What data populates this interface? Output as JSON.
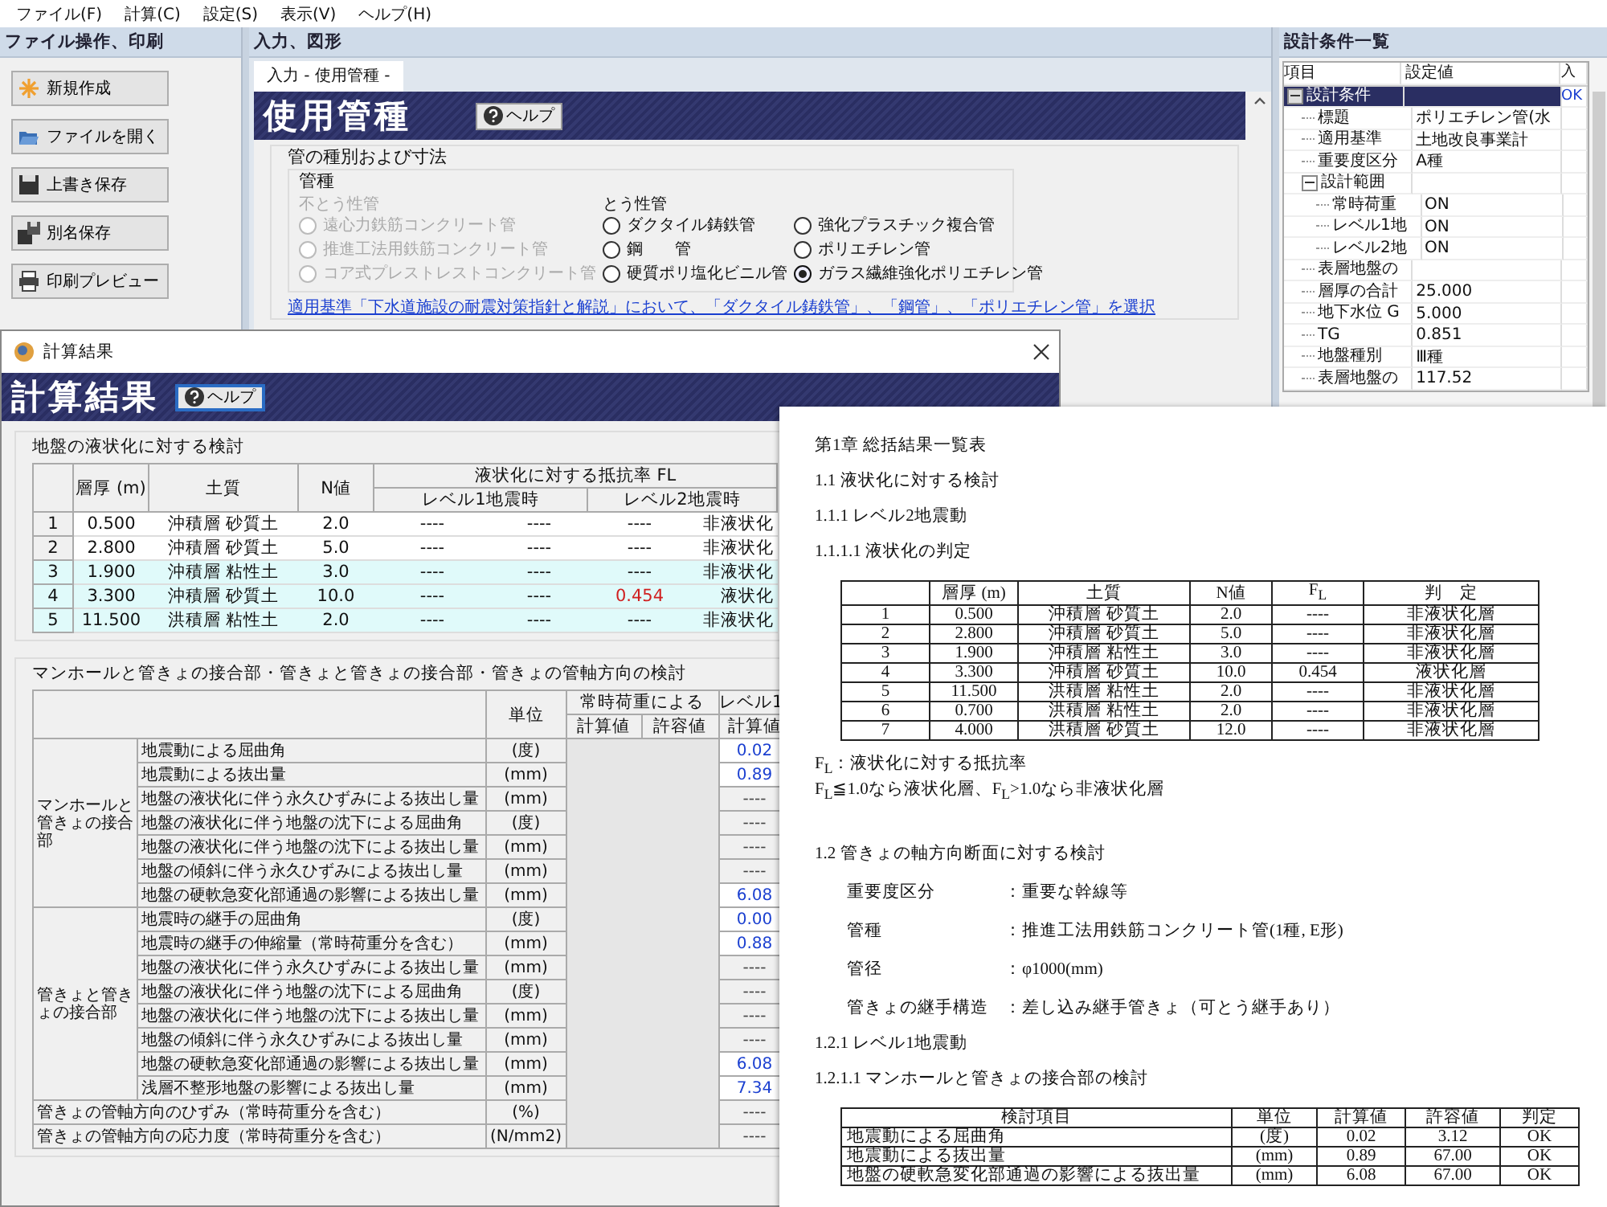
{
  "menu": [
    "ファイル(F)",
    "計算(C)",
    "設定(S)",
    "表示(V)",
    "ヘルプ(H)"
  ],
  "left_panel": {
    "title": "ファイル操作、印刷",
    "buttons": [
      "新規作成",
      "ファイルを開く",
      "上書き保存",
      "別名保存",
      "印刷プレビュー"
    ]
  },
  "center_panel": {
    "title": "入力、図形",
    "tab": "入力 - 使用管種 -",
    "heading": "使用管種",
    "help": "ヘルプ",
    "group_title": "管の種別および寸法",
    "pipe_type": {
      "title": "管種",
      "columns": [
        {
          "title": "不とう性管",
          "options": [
            {
              "label": "遠心力鉄筋コンクリート管",
              "selected": false,
              "disabled": true
            },
            {
              "label": "推進工法用鉄筋コンクリート管",
              "selected": false,
              "disabled": true
            },
            {
              "label": "コア式プレストレストコンクリート管",
              "selected": false,
              "disabled": true
            }
          ]
        },
        {
          "title": "とう性管",
          "options": [
            {
              "label": "ダクタイル鋳鉄管",
              "selected": false,
              "disabled": false
            },
            {
              "label": "鋼　　管",
              "selected": false,
              "disabled": false
            },
            {
              "label": "硬質ポリ塩化ビニル管",
              "selected": false,
              "disabled": false
            }
          ]
        },
        {
          "options": [
            {
              "label": "強化プラスチック複合管",
              "selected": false,
              "disabled": false
            },
            {
              "label": "ポリエチレン管",
              "selected": false,
              "disabled": false
            },
            {
              "label": "ガラス繊維強化ポリエチレン管",
              "selected": true,
              "disabled": false
            }
          ]
        }
      ]
    },
    "note": "適用基準「下水道施設の耐震対策指針と解説」において、「ダクタイル鋳鉄管」、「鋼管」、「ポリエチレン管」を選択"
  },
  "right_panel": {
    "title": "設計条件一覧",
    "columns": [
      "項目",
      "設定値",
      "入"
    ],
    "rows": [
      {
        "item": "設計条件",
        "status": "OK",
        "selected": true,
        "expanded": true,
        "children": [
          {
            "item": "標題",
            "value": "ポリエチレン管(水",
            "selected": false
          },
          {
            "item": "適用基準",
            "value": "土地改良事業計",
            "selected": false
          },
          {
            "item": "重要度区分",
            "value": "A種",
            "selected": false
          },
          {
            "item": "設計範囲",
            "selected": false,
            "expanded": true,
            "children": [
              {
                "item": "常時荷重",
                "value": "ON",
                "selected": false
              },
              {
                "item": "レベル1地",
                "value": "ON",
                "selected": false
              },
              {
                "item": "レベル2地",
                "value": "ON",
                "selected": false
              }
            ]
          },
          {
            "item": "表層地盤の",
            "selected": false
          },
          {
            "item": "層厚の合計",
            "value": "25.000",
            "selected": false
          },
          {
            "item": "地下水位 G",
            "value": "5.000",
            "selected": false
          },
          {
            "item": "TG",
            "value": "0.851",
            "selected": false
          },
          {
            "item": "地盤種別",
            "value": "Ⅲ種",
            "selected": false
          },
          {
            "item": "表層地盤の",
            "value": "117.52",
            "selected": false
          }
        ]
      }
    ]
  },
  "dialog": {
    "title": "計算結果",
    "heading": "計算結果",
    "help": "ヘルプ",
    "liquefaction": {
      "title": "地盤の液状化に対する検討",
      "headers": {
        "thickness": "層厚 (m)",
        "soil": "土質",
        "n": "N値",
        "fl": "液状化に対する抵抗率 FL",
        "level1": "レベル1地震時",
        "level2": "レベル2地震時"
      },
      "rows": [
        {
          "no": "1",
          "thickness": "0.500",
          "soil": "沖積層 砂質土",
          "n": "2.0",
          "values": [
            "----",
            "----",
            "----",
            "非液状化"
          ],
          "highlighted": false,
          "alert": false
        },
        {
          "no": "2",
          "thickness": "2.800",
          "soil": "沖積層 砂質土",
          "n": "5.0",
          "values": [
            "----",
            "----",
            "----",
            "非液状化"
          ],
          "highlighted": false,
          "alert": false
        },
        {
          "no": "3",
          "thickness": "1.900",
          "soil": "沖積層 粘性土",
          "n": "3.0",
          "values": [
            "----",
            "----",
            "----",
            "非液状化"
          ],
          "highlighted": true,
          "alert": false
        },
        {
          "no": "4",
          "thickness": "3.300",
          "soil": "沖積層 砂質土",
          "n": "10.0",
          "values": [
            "----",
            "----",
            "0.454",
            "液状化"
          ],
          "highlighted": true,
          "alert": true
        },
        {
          "no": "5",
          "thickness": "11.500",
          "soil": "洪積層 粘性土",
          "n": "2.0",
          "values": [
            "----",
            "----",
            "----",
            "非液状化"
          ],
          "highlighted": true,
          "alert": false
        }
      ]
    },
    "joints": {
      "title": "マンホールと管きょの接合部・管きょと管きょの接合部・管きょの管軸方向の検討",
      "headers": {
        "unit": "単位",
        "normal": "常時荷重による",
        "calc": "計算値",
        "allow": "許容値",
        "level1": "レベル1",
        "calc2": "計算値"
      },
      "groups": [
        {
          "label": "マンホールと管きょの接合部",
          "rows": [
            {
              "item": "地震動による屈曲角",
              "unit": "(度)",
              "value": "0.02",
              "kind": "number"
            },
            {
              "item": "地震動による抜出量",
              "unit": "(mm)",
              "value": "0.89",
              "kind": "number"
            },
            {
              "item": "地盤の液状化に伴う永久ひずみによる抜出し量",
              "unit": "(mm)",
              "value": "----",
              "kind": "dash"
            },
            {
              "item": "地盤の液状化に伴う地盤の沈下による屈曲角",
              "unit": "(度)",
              "value": "----",
              "kind": "dash"
            },
            {
              "item": "地盤の液状化に伴う地盤の沈下による抜出し量",
              "unit": "(mm)",
              "value": "----",
              "kind": "dash"
            },
            {
              "item": "地盤の傾斜に伴う永久ひずみによる抜出し量",
              "unit": "(mm)",
              "value": "----",
              "kind": "dash"
            },
            {
              "item": "地盤の硬軟急変化部通過の影響による抜出し量",
              "unit": "(mm)",
              "value": "6.08",
              "kind": "number"
            }
          ]
        },
        {
          "label": "管きょと管きょの接合部",
          "rows": [
            {
              "item": "地震時の継手の屈曲角",
              "unit": "(度)",
              "value": "0.00",
              "kind": "number"
            },
            {
              "item": "地震時の継手の伸縮量（常時荷重分を含む）",
              "unit": "(mm)",
              "value": "0.88",
              "kind": "number"
            },
            {
              "item": "地盤の液状化に伴う永久ひずみによる抜出し量",
              "unit": "(mm)",
              "value": "----",
              "kind": "dash"
            },
            {
              "item": "地盤の液状化に伴う地盤の沈下による屈曲角",
              "unit": "(度)",
              "value": "----",
              "kind": "dash"
            },
            {
              "item": "地盤の液状化に伴う地盤の沈下による抜出し量",
              "unit": "(mm)",
              "value": "----",
              "kind": "dash"
            },
            {
              "item": "地盤の傾斜に伴う永久ひずみによる抜出し量",
              "unit": "(mm)",
              "value": "----",
              "kind": "dash"
            },
            {
              "item": "地盤の硬軟急変化部通過の影響による抜出し量",
              "unit": "(mm)",
              "value": "6.08",
              "kind": "number"
            },
            {
              "item": "浅層不整形地盤の影響による抜出し量",
              "unit": "(mm)",
              "value": "7.34",
              "kind": "number"
            }
          ]
        }
      ],
      "rows": [
        {
          "item": "管きょの管軸方向のひずみ（常時荷重分を含む）",
          "unit": "(%)",
          "value": "----",
          "kind": "dash"
        },
        {
          "item": "管きょの管軸方向の応力度（常時荷重分を含む）",
          "unit": "(N/mm2)",
          "value": "----",
          "kind": "dash"
        }
      ]
    }
  },
  "report": {
    "blocks": [
      {
        "kind": "heading",
        "text": "第1章 総括結果一覧表"
      },
      {
        "kind": "heading",
        "text": "1.1 液状化に対する検討"
      },
      {
        "kind": "heading",
        "text": "1.1.1 レベル2地震動"
      },
      {
        "kind": "heading",
        "text": "1.1.1.1 液状化の判定"
      },
      {
        "kind": "table",
        "columns": [
          "",
          "層厚 (m)",
          "土質",
          "N値",
          "F$_{L}$",
          "判　定"
        ],
        "rows": [
          [
            "1",
            "0.500",
            "沖積層 砂質土",
            "2.0",
            "----",
            "非液状化層"
          ],
          [
            "2",
            "2.800",
            "沖積層 砂質土",
            "5.0",
            "----",
            "非液状化層"
          ],
          [
            "3",
            "1.900",
            "沖積層 粘性土",
            "3.0",
            "----",
            "非液状化層"
          ],
          [
            "4",
            "3.300",
            "沖積層 砂質土",
            "10.0",
            "0.454",
            "液状化層"
          ],
          [
            "5",
            "11.500",
            "洪積層 粘性土",
            "2.0",
            "----",
            "非液状化層"
          ],
          [
            "6",
            "0.700",
            "洪積層 粘性土",
            "2.0",
            "----",
            "非液状化層"
          ],
          [
            "7",
            "4.000",
            "洪積層 砂質土",
            "12.0",
            "----",
            "非液状化層"
          ]
        ]
      },
      {
        "kind": "note",
        "lines": [
          "F$_{L}$：液状化に対する抵抗率",
          "F$_{L}$≦1.0なら液状化層、F$_{L}$>1.0なら非液状化層"
        ]
      },
      {
        "kind": "heading",
        "text": "1.2 管きょの軸方向断面に対する検討"
      },
      {
        "kind": "field",
        "label": "重要度区分",
        "value": "：重要な幹線等"
      },
      {
        "kind": "field",
        "label": "管種",
        "value": "：推進工法用鉄筋コンクリート管(1種, E形)"
      },
      {
        "kind": "field",
        "label": "管径",
        "value": "：φ1000(mm)"
      },
      {
        "kind": "field",
        "label": "管きょの継手構造",
        "value": "：差し込み継手管きょ（可とう継手あり）"
      },
      {
        "kind": "heading",
        "text": "1.2.1 レベル1地震動"
      },
      {
        "kind": "heading",
        "text": "1.2.1.1 マンホールと管きょの接合部の検討"
      },
      {
        "kind": "table",
        "columns": [
          "検討項目",
          "単位",
          "計算値",
          "許容値",
          "判定"
        ],
        "rows": [
          [
            "地震動による屈曲角",
            "(度)",
            "0.02",
            "3.12",
            "OK"
          ],
          [
            "地震動による抜出量",
            "(mm)",
            "0.89",
            "67.00",
            "OK"
          ],
          [
            "地盤の硬軟急変化部通過の影響による抜出量",
            "(mm)",
            "6.08",
            "67.00",
            "OK"
          ]
        ]
      }
    ]
  }
}
